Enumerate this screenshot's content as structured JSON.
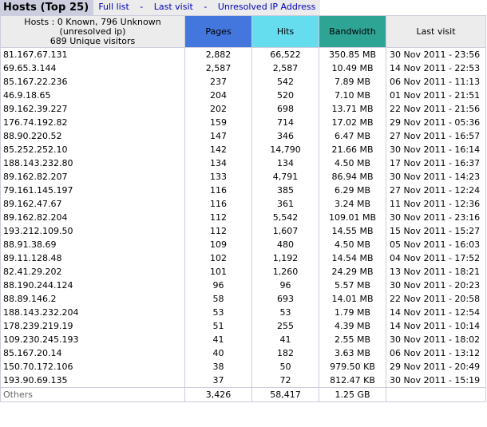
{
  "header": {
    "title": "Hosts (Top 25)",
    "links": [
      "Full list",
      "Last visit",
      "Unresolved IP Address"
    ],
    "separator": "-"
  },
  "table": {
    "host_summary": [
      "Hosts : 0 Known, 796 Unknown",
      "(unresolved ip)",
      "689 Unique visitors"
    ],
    "columns": {
      "pages": "Pages",
      "hits": "Hits",
      "bandwidth": "Bandwidth",
      "last_visit": "Last visit"
    },
    "colors": {
      "pages": "#4477dd",
      "hits": "#66ddee",
      "bandwidth": "#2ea495",
      "header_bg": "#ececec",
      "title_bg": "#cccdde",
      "link": "#0000b9"
    },
    "rows": [
      [
        "81.167.67.131",
        "2,882",
        "66,522",
        "350.85 MB",
        "30 Nov 2011 - 23:56"
      ],
      [
        "69.65.3.144",
        "2,587",
        "2,587",
        "10.49 MB",
        "14 Nov 2011 - 22:53"
      ],
      [
        "85.167.22.236",
        "237",
        "542",
        "7.89 MB",
        "06 Nov 2011 - 11:13"
      ],
      [
        "46.9.18.65",
        "204",
        "520",
        "7.10 MB",
        "01 Nov 2011 - 21:51"
      ],
      [
        "89.162.39.227",
        "202",
        "698",
        "13.71 MB",
        "22 Nov 2011 - 21:56"
      ],
      [
        "176.74.192.82",
        "159",
        "714",
        "17.02 MB",
        "29 Nov 2011 - 05:36"
      ],
      [
        "88.90.220.52",
        "147",
        "346",
        "6.47 MB",
        "27 Nov 2011 - 16:57"
      ],
      [
        "85.252.252.10",
        "142",
        "14,790",
        "21.66 MB",
        "30 Nov 2011 - 16:14"
      ],
      [
        "188.143.232.80",
        "134",
        "134",
        "4.50 MB",
        "17 Nov 2011 - 16:37"
      ],
      [
        "89.162.82.207",
        "133",
        "4,791",
        "86.94 MB",
        "30 Nov 2011 - 14:23"
      ],
      [
        "79.161.145.197",
        "116",
        "385",
        "6.29 MB",
        "27 Nov 2011 - 12:24"
      ],
      [
        "89.162.47.67",
        "116",
        "361",
        "3.24 MB",
        "11 Nov 2011 - 12:36"
      ],
      [
        "89.162.82.204",
        "112",
        "5,542",
        "109.01 MB",
        "30 Nov 2011 - 23:16"
      ],
      [
        "193.212.109.50",
        "112",
        "1,607",
        "14.55 MB",
        "15 Nov 2011 - 15:27"
      ],
      [
        "88.91.38.69",
        "109",
        "480",
        "4.50 MB",
        "05 Nov 2011 - 16:03"
      ],
      [
        "89.11.128.48",
        "102",
        "1,192",
        "14.54 MB",
        "04 Nov 2011 - 17:52"
      ],
      [
        "82.41.29.202",
        "101",
        "1,260",
        "24.29 MB",
        "13 Nov 2011 - 18:21"
      ],
      [
        "88.190.244.124",
        "96",
        "96",
        "5.57 MB",
        "30 Nov 2011 - 20:23"
      ],
      [
        "88.89.146.2",
        "58",
        "693",
        "14.01 MB",
        "22 Nov 2011 - 20:58"
      ],
      [
        "188.143.232.204",
        "53",
        "53",
        "1.79 MB",
        "14 Nov 2011 - 12:54"
      ],
      [
        "178.239.219.19",
        "51",
        "255",
        "4.39 MB",
        "14 Nov 2011 - 10:14"
      ],
      [
        "109.230.245.193",
        "41",
        "41",
        "2.55 MB",
        "30 Nov 2011 - 18:02"
      ],
      [
        "85.167.20.14",
        "40",
        "182",
        "3.63 MB",
        "06 Nov 2011 - 13:12"
      ],
      [
        "150.70.172.106",
        "38",
        "50",
        "979.50 KB",
        "29 Nov 2011 - 20:49"
      ],
      [
        "193.90.69.135",
        "37",
        "72",
        "812.47 KB",
        "30 Nov 2011 - 15:19"
      ]
    ],
    "others": [
      "Others",
      "3,426",
      "58,417",
      "1.25 GB",
      ""
    ]
  }
}
